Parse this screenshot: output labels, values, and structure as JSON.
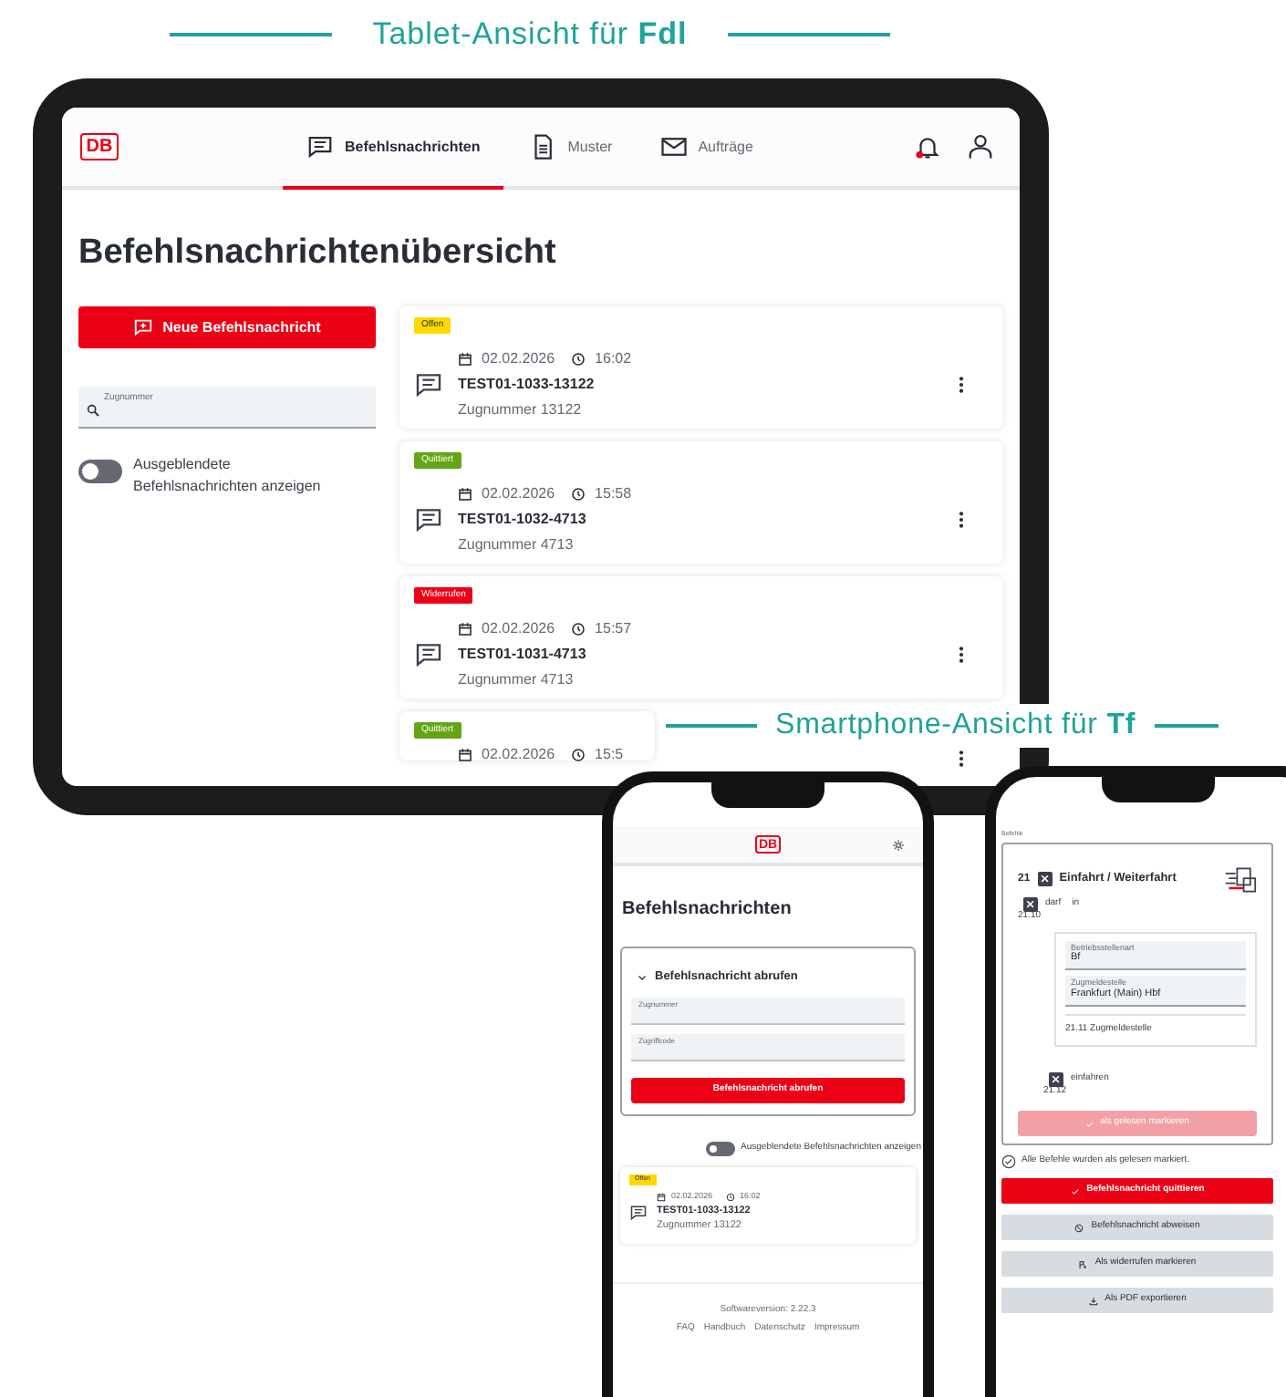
{
  "tablet_caption": "Tablet-Ansicht für **Fdl**",
  "tablet": {
    "logo": "DB",
    "nav_tabs": [
      {
        "label": "Befehlsnachrichten",
        "selected": true
      },
      {
        "label": "Muster",
        "selected": false
      },
      {
        "label": "Aufträge",
        "selected": false
      }
    ],
    "title": "Befehlsnachrichtenübersicht",
    "new_button": "Neue Befehlsnachricht",
    "search": {
      "placeholder": "Zugnummer"
    },
    "toggle": {
      "label": "Ausgeblendete Befehlsnachrichten anzeigen",
      "on": false
    },
    "messages": [
      {
        "status": "Offen",
        "kind": "open",
        "date": "02.02.2026",
        "time": "16:02",
        "id": "TEST01-1033-13122",
        "train": "Zugnummer 13122"
      },
      {
        "status": "Quittiert",
        "kind": "acknowledged",
        "date": "02.02.2026",
        "time": "15:58",
        "id": "TEST01-1032-4713",
        "train": "Zugnummer 4713"
      },
      {
        "status": "Widerrufen",
        "kind": "revoked",
        "date": "02.02.2026",
        "time": "15:57",
        "id": "TEST01-1031-4713",
        "train": "Zugnummer 4713"
      },
      {
        "status": "Quittiert",
        "kind": "acknowledged",
        "date": "02.02.2026",
        "time": "15:5"
      }
    ]
  },
  "smartphone_caption": "Smartphone-Ansicht für **Tf**",
  "phone_list": {
    "logo": "DB",
    "title": "Befehlsnachrichten",
    "panel": {
      "title": "Befehlsnachricht abrufen",
      "expanded": true,
      "fields": [
        {
          "placeholder": "Zugnummer"
        },
        {
          "placeholder": "Zugriffcode"
        }
      ],
      "button": "Befehlsnachricht abrufen"
    },
    "toggle": {
      "label": "Ausgeblendete Befehlsnachrichten anzeigen",
      "on": false
    },
    "messages": [
      {
        "status": "Offen",
        "kind": "open",
        "date": "02.02.2026",
        "time": "16:02",
        "id": "TEST01-1033-13122",
        "train": "Zugnummer 13122"
      }
    ],
    "footer": {
      "version": "Softwareversion: 2.22.3",
      "links": [
        "FAQ",
        "Handbuch",
        "Datenschutz",
        "Impressum"
      ]
    }
  },
  "phone_detail": {
    "section_label": "Befehle",
    "command": {
      "number": "21",
      "checked": true,
      "title": "Einfahrt / Weiterfahrt",
      "items": [
        {
          "kind": "check",
          "checked": true,
          "text": "darf",
          "extra": "in",
          "number": "21.10"
        },
        {
          "kind": "fields",
          "fields": [
            {
              "label": "Betriebsstellenart",
              "value": "Bf"
            },
            {
              "label": "Zugmeldestelle",
              "value": "Frankfurt (Main) Hbf"
            }
          ],
          "caption": "21.11 Zugmeldestelle"
        },
        {
          "kind": "check",
          "checked": true,
          "text": "einfahren",
          "number": "21.12"
        }
      ],
      "mark_button": {
        "label": "als gelesen markieren",
        "disabled": true
      }
    },
    "status_note": "Alle Befehle wurden als gelesen markiert.",
    "actions": [
      {
        "label": "Befehlsnachricht quittieren",
        "kind": "primary"
      },
      {
        "label": "Befehlsnachricht abweisen",
        "kind": "secondary"
      },
      {
        "label": "Als widerrufen markieren",
        "kind": "secondary"
      },
      {
        "label": "Als PDF exportieren",
        "kind": "secondary"
      }
    ]
  }
}
